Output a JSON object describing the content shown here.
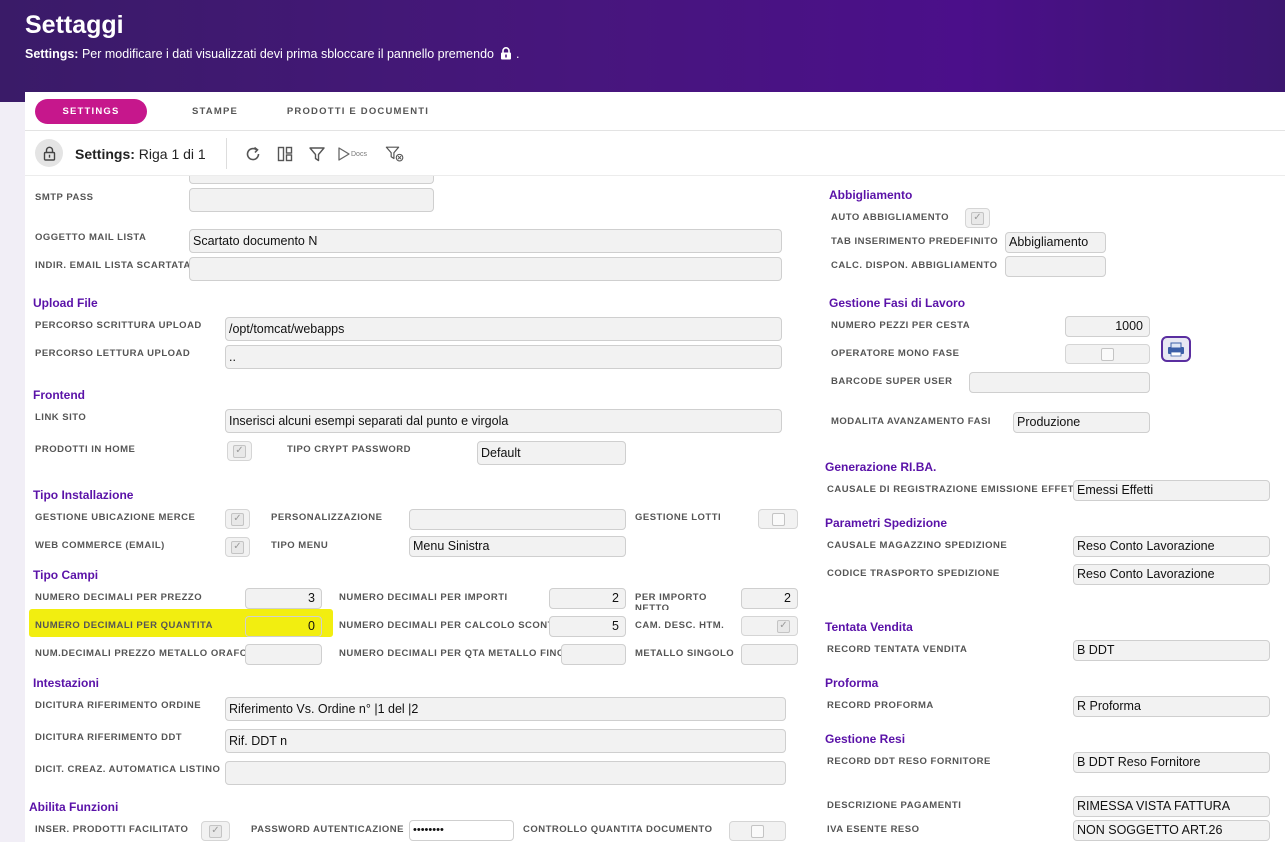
{
  "header": {
    "title": "Settaggi",
    "subtitle_bold": "Settings:",
    "subtitle_text": "Per modificare i dati visualizzati devi prima sbloccare il pannello premendo",
    "subtitle_end": "."
  },
  "tabs": [
    {
      "label": "SETTINGS",
      "active": true
    },
    {
      "label": "STAMPE",
      "active": false
    },
    {
      "label": "PRODOTTI E DOCUMENTI",
      "active": false
    }
  ],
  "toolbar": {
    "title_bold": "Settings:",
    "title_text": "Riga 1 di 1",
    "docs_label": "Docs",
    "icons": [
      "refresh-icon",
      "columns-icon",
      "filter-icon",
      "docs-icon",
      "clear-filter-icon"
    ]
  },
  "left": {
    "smtp_pass_label": "SMTP PASS",
    "smtp_pass_value": "",
    "oggetto_mail_label": "OGGETTO MAIL LISTA",
    "oggetto_mail_value": "Scartato documento N",
    "indir_email_label": "INDIR. EMAIL LISTA SCARTATA",
    "indir_email_value": "",
    "upload_section": "Upload File",
    "perc_scrittura_label": "PERCORSO SCRITTURA UPLOAD",
    "perc_scrittura_value": "/opt/tomcat/webapps",
    "perc_lettura_label": "PERCORSO LETTURA UPLOAD",
    "perc_lettura_value": "..",
    "frontend_section": "Frontend",
    "link_sito_label": "LINK SITO",
    "link_sito_value": "Inserisci alcuni esempi separati dal punto e virgola",
    "prodotti_home_label": "PRODOTTI IN HOME",
    "prodotti_home_checked": true,
    "tipo_crypt_label": "TIPO CRYPT PASSWORD",
    "tipo_crypt_value": "Default",
    "installazione_section": "Tipo Installazione",
    "gest_ubicazione_label": "GESTIONE UBICAZIONE MERCE",
    "gest_ubicazione_checked": true,
    "personalizzazione_label": "PERSONALIZZAZIONE",
    "personalizzazione_value": "",
    "gest_lotti_label": "GESTIONE LOTTI",
    "gest_lotti_checked": false,
    "web_commerce_label": "WEB COMMERCE (EMAIL)",
    "web_commerce_checked": true,
    "tipo_menu_label": "TIPO MENU",
    "tipo_menu_value": "Menu Sinistra",
    "campi_section": "Tipo Campi",
    "dec_prezzo_label": "NUMERO DECIMALI PER PREZZO",
    "dec_prezzo_value": "3",
    "dec_importi_label": "NUMERO DECIMALI PER IMPORTI",
    "dec_importi_value": "2",
    "per_importo_netto_label": "PER IMPORTO NETTO",
    "per_importo_netto_value": "2",
    "dec_quantita_label": "NUMERO DECIMALI PER QUANTITA",
    "dec_quantita_value": "0",
    "dec_sconti_label": "NUMERO DECIMALI PER CALCOLO SCONTI",
    "dec_sconti_value": "5",
    "cam_desc_label": "CAM. DESC. HTM.",
    "cam_desc_checked": true,
    "dec_orafo_label": "NUM.DECIMALI PREZZO METALLO ORAFO",
    "dec_orafo_value": "",
    "dec_qta_fino_label": "NUMERO DECIMALI PER QTA METALLO FINO",
    "dec_qta_fino_value": "",
    "metallo_singolo_label": "METALLO SINGOLO",
    "metallo_singolo_value": "",
    "intestazioni_section": "Intestazioni",
    "dic_ordine_label": "DICITURA RIFERIMENTO ORDINE",
    "dic_ordine_value": "Riferimento Vs. Ordine n° |1 del |2",
    "dic_ddt_label": "DICITURA RIFERIMENTO DDT",
    "dic_ddt_value": "Rif. DDT n",
    "dic_listino_label": "DICIT. CREAZ. AUTOMATICA LISTINO",
    "dic_listino_value": "",
    "abilita_section": "Abilita Funzioni",
    "inser_prodotti_label": "INSER. PRODOTTI FACILITATO",
    "inser_prodotti_checked": true,
    "password_aut_label": "PASSWORD AUTENTICAZIONE",
    "password_aut_value": "••••••••",
    "controllo_qta_label": "CONTROLLO QUANTITA DOCUMENTO",
    "controllo_qta_checked": false
  },
  "right": {
    "abbigliamento_section": "Abbigliamento",
    "auto_abb_label": "AUTO ABBIGLIAMENTO",
    "auto_abb_checked": true,
    "tab_ins_label": "TAB INSERIMENTO PREDEFINITO",
    "tab_ins_value": "Abbigliamento",
    "calc_dispon_label": "CALC. DISPON. ABBIGLIAMENTO",
    "calc_dispon_value": "",
    "fasi_section": "Gestione Fasi di Lavoro",
    "pezzi_cesta_label": "NUMERO PEZZI PER CESTA",
    "pezzi_cesta_value": "1000",
    "operatore_mono_label": "OPERATORE MONO FASE",
    "operatore_mono_checked": false,
    "barcode_label": "BARCODE SUPER USER",
    "barcode_value": "",
    "modalita_label": "MODALITA AVANZAMENTO FASI",
    "modalita_value": "Produzione",
    "riba_section": "Generazione RI.BA.",
    "causale_riba_label": "CAUSALE DI REGISTRAZIONE EMISSIONE EFFETTI",
    "causale_riba_value": "Emessi Effetti",
    "spedizione_section": "Parametri Spedizione",
    "causale_mag_label": "CAUSALE MAGAZZINO SPEDIZIONE",
    "causale_mag_value": "Reso Conto Lavorazione",
    "codice_trasp_label": "CODICE TRASPORTO SPEDIZIONE",
    "codice_trasp_value": "Reso Conto Lavorazione",
    "tentata_section": "Tentata Vendita",
    "record_tentata_label": "RECORD TENTATA VENDITA",
    "record_tentata_value": "B DDT",
    "proforma_section": "Proforma",
    "record_proforma_label": "RECORD PROFORMA",
    "record_proforma_value": "R Proforma",
    "resi_section": "Gestione Resi",
    "record_reso_label": "RECORD DDT RESO FORNITORE",
    "record_reso_value": "B DDT Reso Fornitore",
    "desc_pagamenti_label": "DESCRIZIONE PAGAMENTI",
    "desc_pagamenti_value": "RIMESSA VISTA FATTURA",
    "iva_esente_label": "IVA ESENTE RESO",
    "iva_esente_value": "NON SOGGETTO ART.26"
  }
}
